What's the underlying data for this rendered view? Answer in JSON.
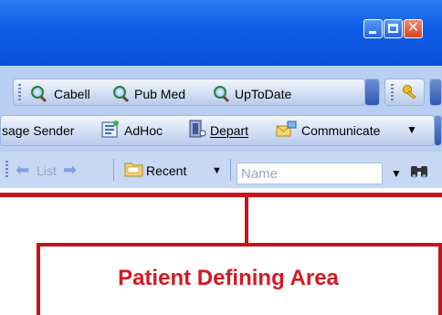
{
  "toolbar_row1": {
    "cabell": "Cabell",
    "pubmed": "Pub Med",
    "uptodate": "UpToDate"
  },
  "toolbar_row2": {
    "message_sender": "sage Sender",
    "adhoc": "AdHoc",
    "depart": "Depart",
    "communicate": "Communicate"
  },
  "toolbar_row3": {
    "list": "List",
    "recent": "Recent",
    "name_placeholder": "Name"
  },
  "callout": {
    "label": "Patient Defining Area",
    "color": "#c4151c"
  },
  "colors": {
    "titlebar": "#0f5ce6",
    "toolbar": "#c8d9f5"
  },
  "icons": [
    "minimize-icon",
    "maximize-icon",
    "close-icon",
    "magnifier-icon",
    "key-icon",
    "adhoc-icon",
    "depart-icon",
    "communicate-icon",
    "back-arrow-icon",
    "forward-arrow-icon",
    "folder-icon",
    "binoculars-icon"
  ]
}
